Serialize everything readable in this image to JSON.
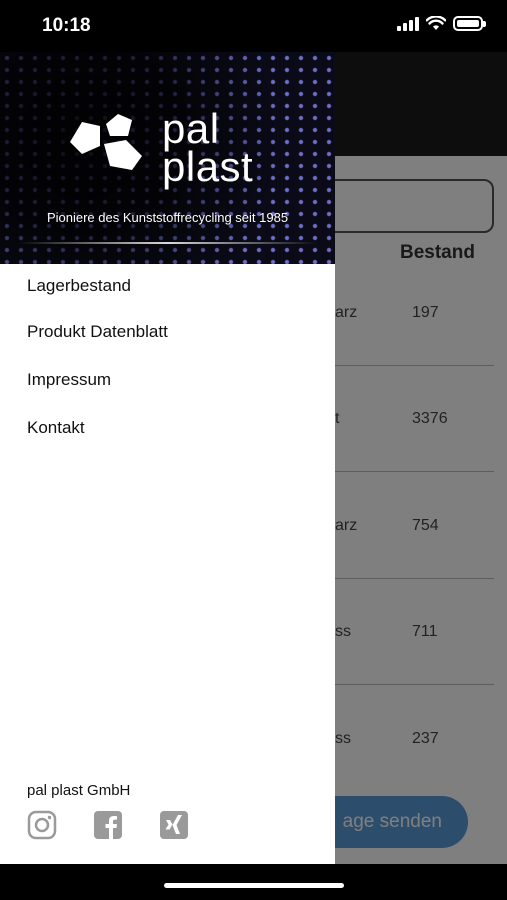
{
  "status_bar": {
    "time": "10:18"
  },
  "background": {
    "column_header": "Bestand",
    "rows": [
      {
        "fragment": "arz",
        "qty": "197"
      },
      {
        "fragment": "t",
        "qty": "3376"
      },
      {
        "fragment": "arz",
        "qty": "754"
      },
      {
        "fragment": "ss",
        "qty": "711"
      },
      {
        "fragment": "ss",
        "qty": "237"
      }
    ],
    "button_label": "age senden"
  },
  "drawer": {
    "brand": {
      "line1": "pal",
      "line2": "plast"
    },
    "tagline": "Pioniere des Kunststoffrecycling seit 1985",
    "menu": [
      {
        "label": "Lagerbestand"
      },
      {
        "label": "Produkt Datenblatt"
      },
      {
        "label": "Impressum"
      },
      {
        "label": "Kontakt"
      }
    ],
    "company": "pal plast GmbH",
    "socials": [
      "instagram-icon",
      "facebook-icon",
      "xing-icon"
    ]
  }
}
